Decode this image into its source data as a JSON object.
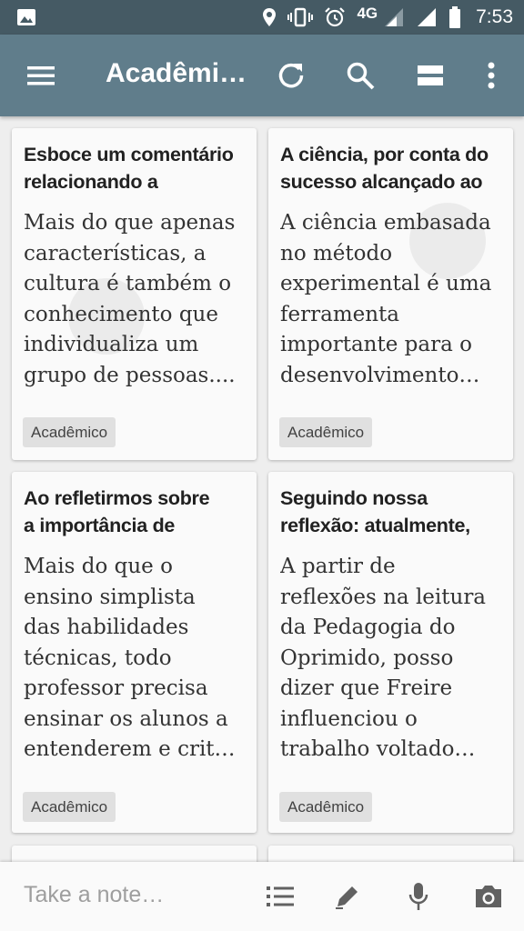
{
  "status": {
    "lte": "4G",
    "time": "7:53"
  },
  "toolbar": {
    "title": "Acadêmi…"
  },
  "cards": [
    {
      "title": [
        "Esboce um comentário",
        "relacionando a"
      ],
      "body": [
        "Mais do que apenas",
        "características, a",
        "cultura é também o",
        "conhecimento que",
        "individualiza um",
        "grupo de pessoas...."
      ],
      "label": "Acadêmico"
    },
    {
      "title": [
        "A ciência, por conta do",
        "sucesso alcançado ao"
      ],
      "body": [
        "A ciência embasada",
        "no método",
        "experimental é uma",
        "ferramenta",
        "importante para o",
        "desenvolvimento…"
      ],
      "label": "Acadêmico"
    },
    {
      "title": [
        "Ao refletirmos sobre",
        "a importância de"
      ],
      "body": [
        "Mais do que o",
        "ensino simplista",
        "das habilidades",
        "técnicas, todo",
        "professor precisa",
        "ensinar os alunos a",
        "entenderem e crit…"
      ],
      "label": "Acadêmico"
    },
    {
      "title": [
        "Seguindo nossa",
        "reflexão: atualmente,"
      ],
      "body": [
        "A partir de",
        "reflexões na leitura",
        "da Pedagogia do",
        "Oprimido, posso",
        "dizer que Freire",
        "influenciou o",
        "trabalho voltado…"
      ],
      "label": "Acadêmico"
    }
  ],
  "bottom_bar": {
    "placeholder": "Take a note…"
  },
  "icons": {
    "menu": "menu-icon",
    "refresh": "refresh-icon",
    "search": "search-icon",
    "view": "single-column-view-icon",
    "more": "more-vert-icon",
    "list": "checklist-icon",
    "pen": "pen-icon",
    "mic": "microphone-icon",
    "camera": "camera-icon"
  },
  "colors": {
    "status_bar": "#455a64",
    "toolbar": "#607d8b",
    "background": "#eeeeee",
    "card": "#fafafa",
    "chip": "#e0e0e0"
  }
}
